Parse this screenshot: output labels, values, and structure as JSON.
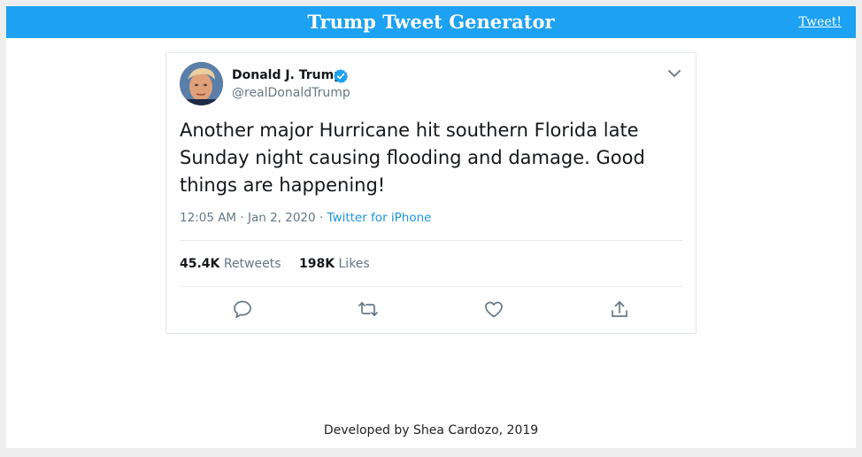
{
  "header": {
    "title": "Trump Tweet Generator",
    "tweet_link": "Tweet!"
  },
  "tweet": {
    "display_name": "Donald J. Trump",
    "handle": "@realDonaldTrump",
    "text": "Another major Hurricane hit southern Florida late Sunday night causing flooding and damage. Good things are happening!",
    "time": "12:05 AM",
    "date": "Jan 2, 2020",
    "source": "Twitter for iPhone",
    "retweets_count": "45.4K",
    "retweets_label": "Retweets",
    "likes_count": "198K",
    "likes_label": "Likes"
  },
  "footer": {
    "credit": "Developed by Shea Cardozo, 2019"
  },
  "colors": {
    "brand": "#1da1f2",
    "verified": "#1da1f2",
    "muted_text": "#657786",
    "link": "#1b95e0"
  },
  "icons": [
    "verified-badge-icon",
    "chevron-down-icon",
    "reply-icon",
    "retweet-icon",
    "like-icon",
    "share-icon"
  ]
}
